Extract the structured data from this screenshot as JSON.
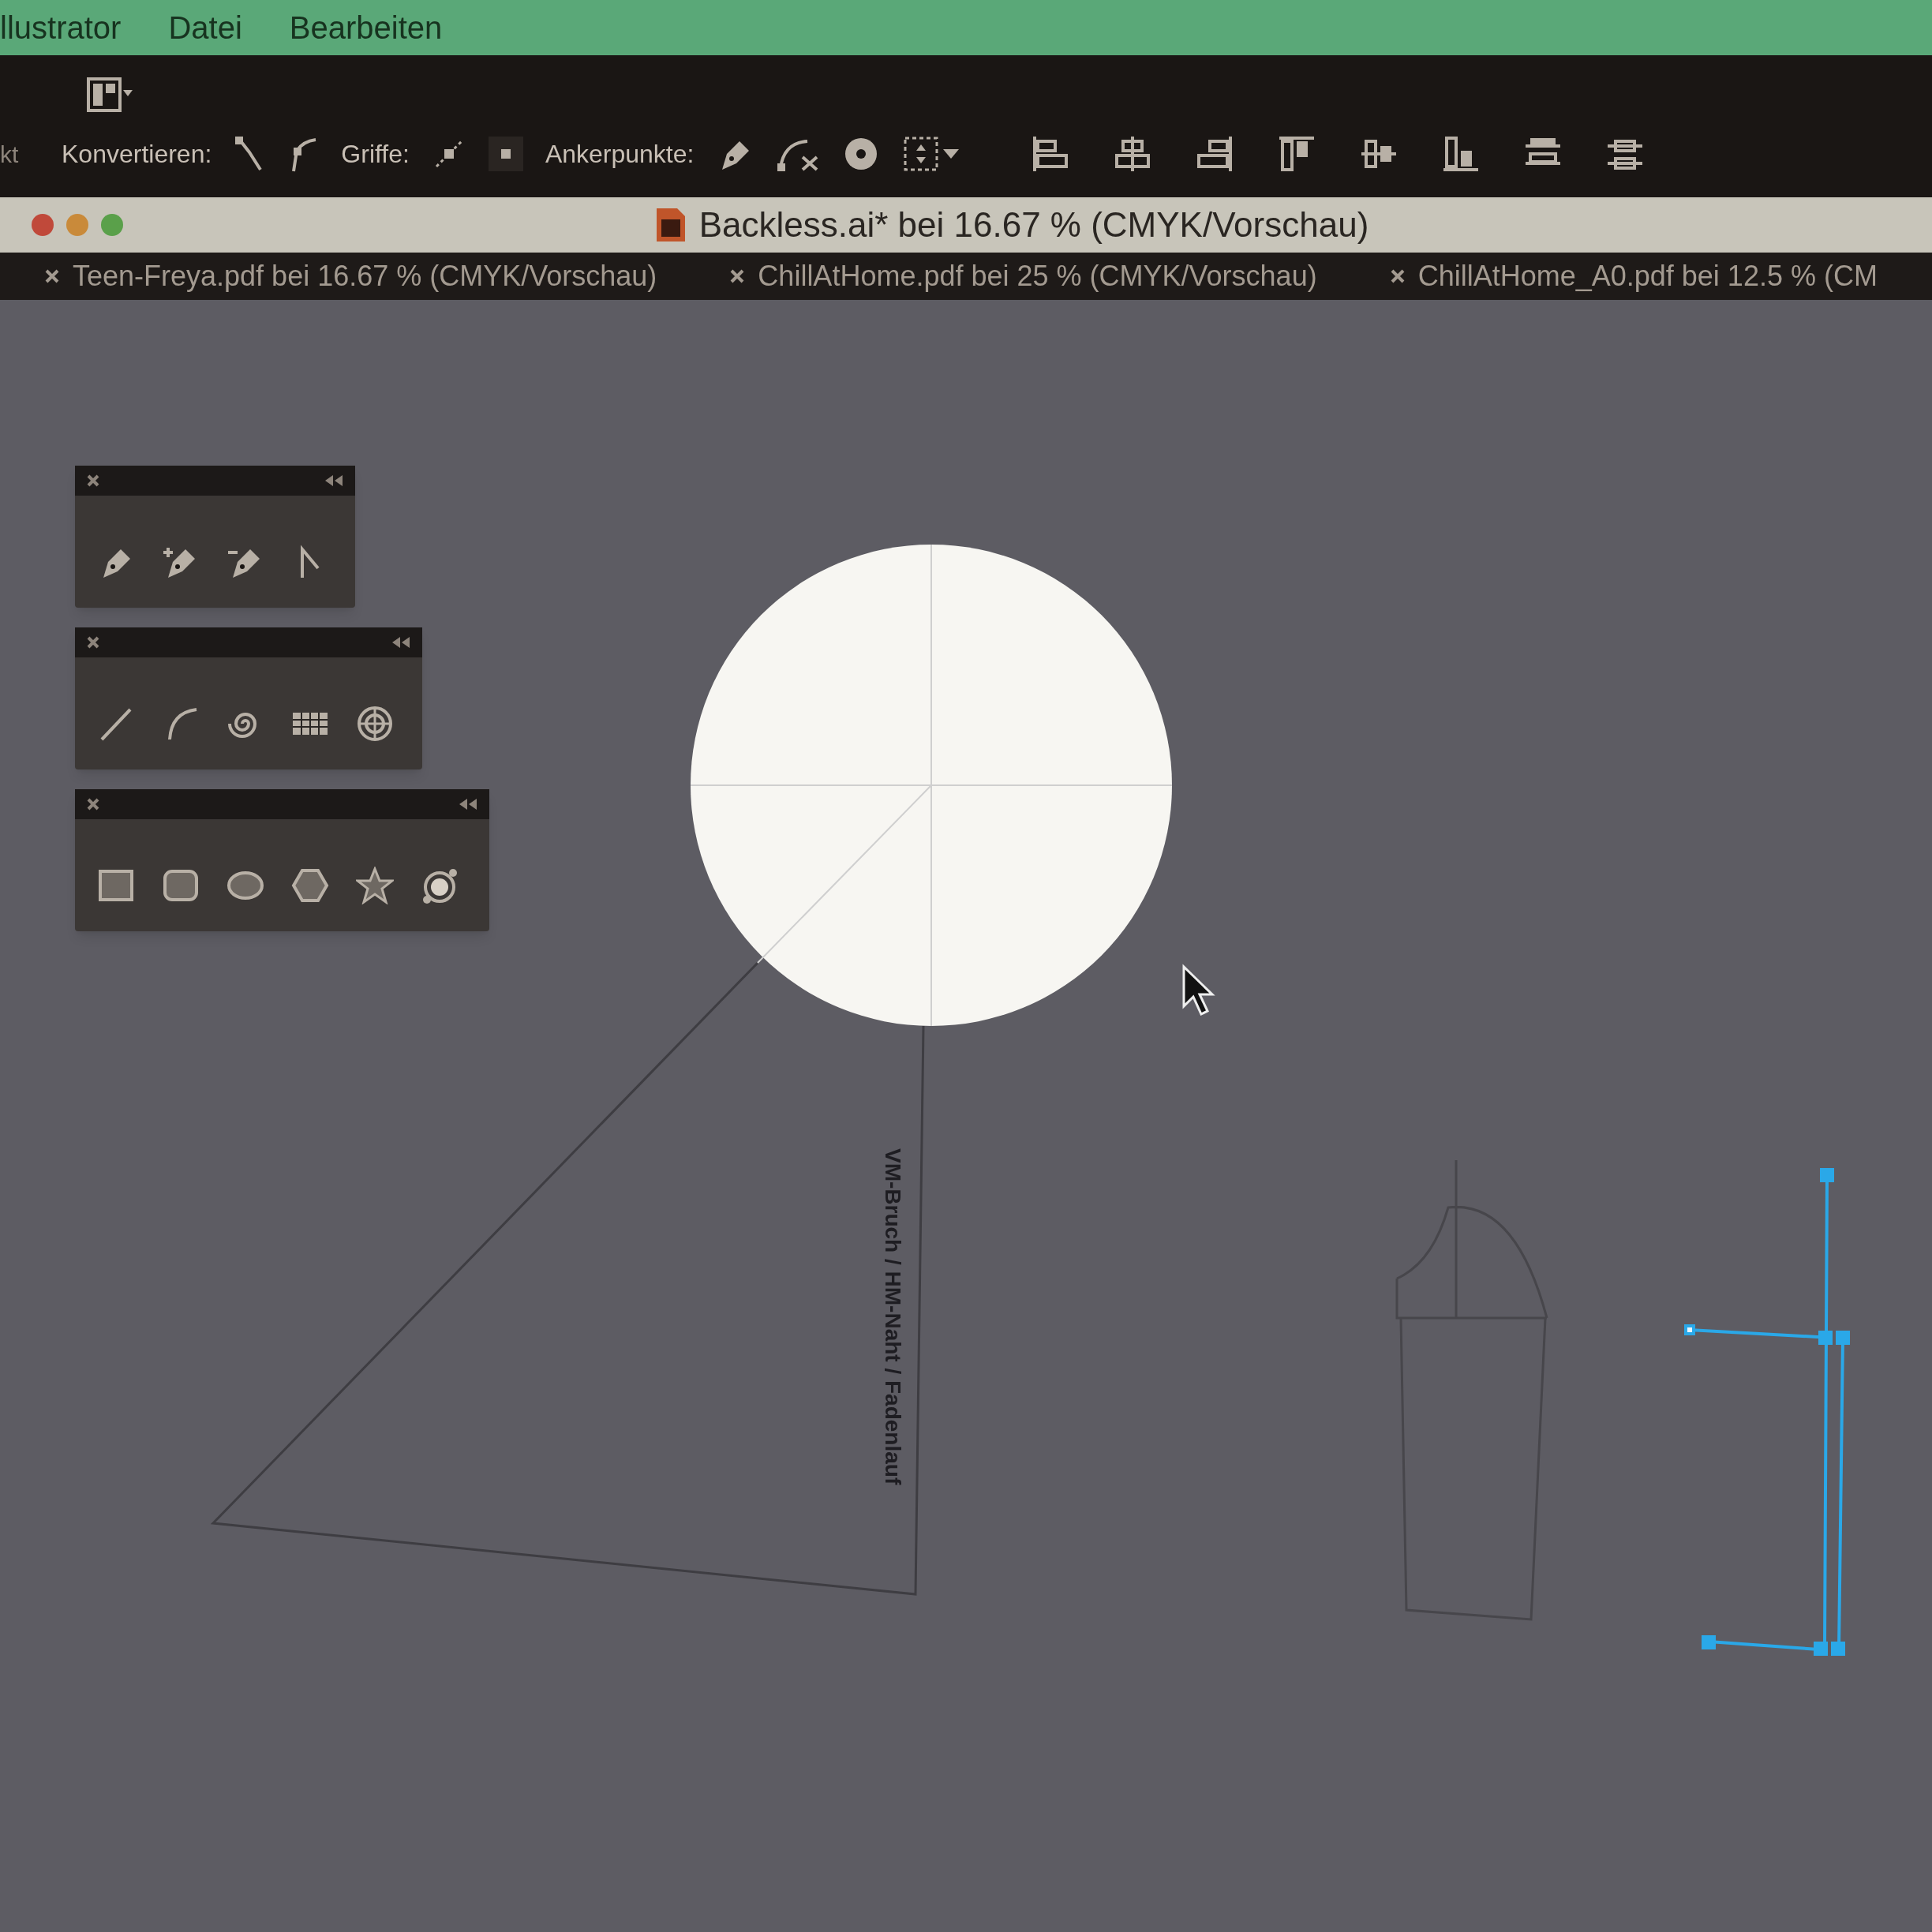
{
  "menu_bar": {
    "items": [
      "llustrator",
      "Datei",
      "Bearbeiten"
    ]
  },
  "control_bar": {
    "cut_label": "kt",
    "labels": [
      "Konvertieren:",
      "Griffe:",
      "Ankerpunkte:"
    ]
  },
  "document_window": {
    "title": "Backless.ai* bei 16.67 % (CMYK/Vorschau)",
    "tabs": [
      {
        "label": "Teen-Freya.pdf bei 16.67 % (CMYK/Vorschau)",
        "selected": false
      },
      {
        "label": "ChillAtHome.pdf bei 25 % (CMYK/Vorschau)",
        "selected": false
      },
      {
        "label": "ChillAtHome_A0.pdf bei 12.5 % (CM",
        "selected": false
      }
    ]
  },
  "artboard": {
    "fold_label": "VM-Bruch / HM-Naht / Fadenlauf"
  }
}
